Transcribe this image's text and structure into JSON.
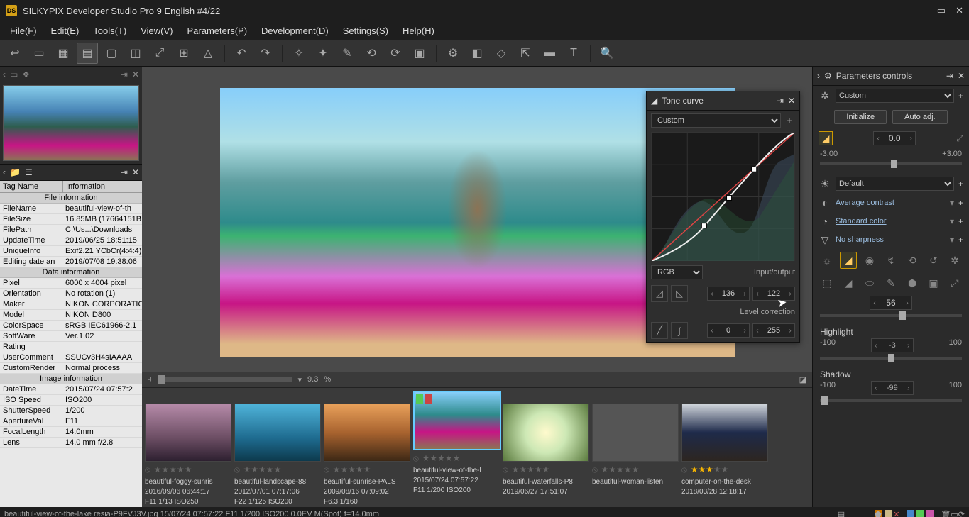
{
  "title": "SILKYPIX Developer Studio Pro 9 English   #4/22",
  "title_icon": "DS",
  "menu": [
    "File(F)",
    "Edit(E)",
    "Tools(T)",
    "View(V)",
    "Parameters(P)",
    "Development(D)",
    "Settings(S)",
    "Help(H)"
  ],
  "info": {
    "hdr_tag": "Tag Name",
    "hdr_info": "Information",
    "sections": [
      {
        "title": "File information",
        "rows": [
          [
            "FileName",
            "beautiful-view-of-th"
          ],
          [
            "FileSize",
            "16.85MB (17664151B"
          ],
          [
            "FilePath",
            "C:\\Us...\\Downloads"
          ],
          [
            "UpdateTime",
            "2019/06/25 18:51:15"
          ],
          [
            "UniqueInfo",
            "Exif2.21 YCbCr(4:4:4)"
          ],
          [
            "Editing date an",
            "2019/07/08 19:38:06"
          ]
        ]
      },
      {
        "title": "Data information",
        "rows": [
          [
            "Pixel",
            "6000 x 4004 pixel"
          ],
          [
            "Orientation",
            "No rotation (1)"
          ],
          [
            "Maker",
            "NIKON CORPORATIO"
          ],
          [
            "Model",
            "NIKON D800"
          ],
          [
            "ColorSpace",
            "sRGB IEC61966-2.1"
          ],
          [
            "SoftWare",
            "Ver.1.02"
          ],
          [
            "Rating",
            ""
          ],
          [
            "UserComment",
            "SSUCv3H4sIAAAA"
          ],
          [
            "CustomRender",
            "Normal process"
          ]
        ]
      },
      {
        "title": "Image information",
        "rows": [
          [
            "DateTime",
            "2015/07/24 07:57:2"
          ],
          [
            "ISO Speed",
            "ISO200"
          ],
          [
            "ShutterSpeed",
            "1/200"
          ],
          [
            "ApertureVal",
            "F11"
          ],
          [
            "FocalLength",
            "14.0mm"
          ],
          [
            "Lens",
            "14.0 mm f/2.8"
          ]
        ]
      }
    ]
  },
  "zoom": "9.3",
  "zoom_unit": "%",
  "tone": {
    "title": "Tone curve",
    "preset": "Custom",
    "channel": "RGB",
    "io_label": "Input/output",
    "io_in": "136",
    "io_out": "122",
    "lc_label": "Level correction",
    "lc_lo": "0",
    "lc_hi": "255"
  },
  "params": {
    "title": "Parameters controls",
    "preset": "Custom",
    "btn_init": "Initialize",
    "btn_auto": "Auto adj.",
    "exp_val": "0.0",
    "exp_lo": "-3.00",
    "exp_hi": "+3.00",
    "wb": "Default",
    "contrast": "Average contrast",
    "color": "Standard color",
    "sharp": "No sharpness",
    "center": "56",
    "highlight_label": "Highlight",
    "highlight_lo": "-100",
    "highlight_val": "-3",
    "highlight_hi": "100",
    "shadow_label": "Shadow",
    "shadow_lo": "-100",
    "shadow_val": "-99",
    "shadow_hi": "100"
  },
  "film": [
    {
      "name": "beautiful-foggy-sunris",
      "date": "2016/09/06 06:44:17",
      "meta": "F11 1/13 ISO250",
      "stars": 0,
      "bg": "linear-gradient(180deg,#b58aa8 0%,#6b4d63 60%,#2d2030 100%)"
    },
    {
      "name": "beautiful-landscape-88",
      "date": "2012/07/01 07:17:06",
      "meta": "F22 1/125 ISO200",
      "stars": 0,
      "bg": "linear-gradient(180deg,#4fb3d9 0%,#1e6b8f 60%,#0d3a4d 100%)"
    },
    {
      "name": "beautiful-sunrise-PALS",
      "date": "2009/08/16 07:09:02",
      "meta": "F6.3 1/160",
      "stars": 0,
      "bg": "linear-gradient(180deg,#e8a05a 0%,#a8632f 50%,#3d2815 100%)"
    },
    {
      "name": "beautiful-view-of-the-l",
      "date": "2015/07/24 07:57:22",
      "meta": "F11 1/200 ISO200",
      "stars": 0,
      "selected": true,
      "marks": [
        "#5c5",
        "#c44"
      ],
      "bg": "linear-gradient(180deg,#87cefa 0%,#2e8b8b 40%,#c71585 70%,#8b7355 100%)"
    },
    {
      "name": "beautiful-waterfalls-P8",
      "date": "2019/06/27 17:51:07",
      "meta": "",
      "stars": 0,
      "bg": "radial-gradient(circle at 50% 50%,#fffacd 0%,#cde8b5 40%,#5a7a3d 100%)"
    },
    {
      "name": "beautiful-woman-listen",
      "date": "",
      "meta": "",
      "stars": 0,
      "bg": "linear-gradient(180deg,#555 0%,#555 100%)"
    },
    {
      "name": "computer-on-the-desk",
      "date": "2018/03/28 12:18:17",
      "meta": "",
      "stars": 3,
      "bg": "linear-gradient(180deg,#cfd4da 0%,#1e2a4a 50%,#2d2620 100%)"
    }
  ],
  "status": "beautiful-view-of-the-lake resia-P9FVJ3V.jpg 15/07/24 07:57:22 F11 1/200 ISO200  0.0EV M(Spot) f=14.0mm"
}
